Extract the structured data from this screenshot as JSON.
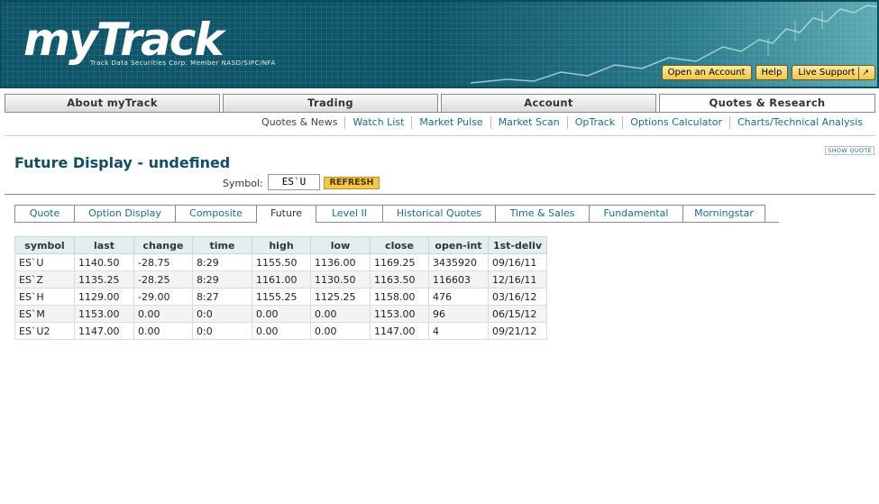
{
  "header": {
    "logo_text": "myTrack",
    "logo_sub": "Track Data Securities Corp. Member NASD/SIPC/NFA",
    "buttons": {
      "open_account": "Open an Account",
      "help": "Help",
      "live_support": "Live Support",
      "live_support_icon": "↗"
    }
  },
  "main_tabs": [
    {
      "label": "About myTrack"
    },
    {
      "label": "Trading"
    },
    {
      "label": "Account"
    },
    {
      "label": "Quotes & Research"
    }
  ],
  "sub_nav": [
    "Quotes & News",
    "Watch List",
    "Market Pulse",
    "Market Scan",
    "OpTrack",
    "Options Calculator",
    "Charts/Technical Analysis"
  ],
  "show_quote": "SHOW QUOTE",
  "page": {
    "title": "Future Display - undefined",
    "symbol_label": "Symbol:",
    "symbol_value": "ES`U",
    "refresh_label": "REFRESH"
  },
  "sub_tabs": [
    "Quote",
    "Option Display",
    "Composite",
    "Future",
    "Level II",
    "Historical Quotes",
    "Time & Sales",
    "Fundamental",
    "Morningstar"
  ],
  "table": {
    "headers": [
      "symbol",
      "last",
      "change",
      "time",
      "high",
      "low",
      "close",
      "open-int",
      "1st-deliv"
    ],
    "rows": [
      [
        "ES`U",
        "1140.50",
        "-28.75",
        "8:29",
        "1155.50",
        "1136.00",
        "1169.25",
        "3435920",
        "09/16/11"
      ],
      [
        "ES`Z",
        "1135.25",
        "-28.25",
        "8:29",
        "1161.00",
        "1130.50",
        "1163.50",
        "116603",
        "12/16/11"
      ],
      [
        "ES`H",
        "1129.00",
        "-29.00",
        "8:27",
        "1155.25",
        "1125.25",
        "1158.00",
        "476",
        "03/16/12"
      ],
      [
        "ES`M",
        "1153.00",
        "0.00",
        "0:0",
        "0.00",
        "0.00",
        "1153.00",
        "96",
        "06/15/12"
      ],
      [
        "ES`U2",
        "1147.00",
        "0.00",
        "0:0",
        "0.00",
        "0.00",
        "1147.00",
        "4",
        "09/21/12"
      ]
    ]
  },
  "colors": {
    "brand": "#0f5569",
    "link": "#1b6f86",
    "button": "#f4c64a"
  }
}
